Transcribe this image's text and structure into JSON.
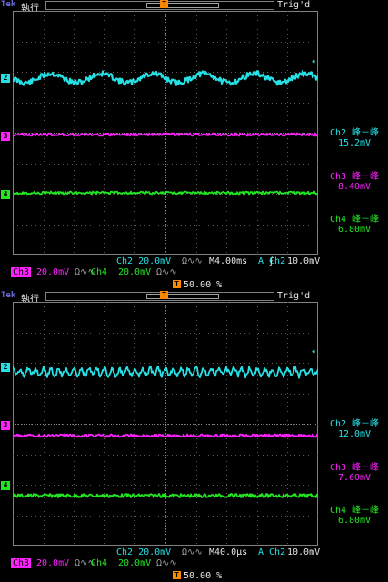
{
  "colors": {
    "ch2": "#27e0e6",
    "ch3": "#ff22ff",
    "ch4": "#22e622",
    "trigger": "#ff8a00",
    "grid": "#5a5a5a"
  },
  "screens": [
    {
      "brand": "Tek",
      "run_state": "執行",
      "trigger_status": "Trig'd",
      "trigger_position": "",
      "measurements": [
        {
          "label": "Ch2 峰－峰",
          "value": "15.2mV"
        },
        {
          "label": "Ch3 峰－峰",
          "value": "8.40mV"
        },
        {
          "label": "Ch4 峰－峰",
          "value": "6.80mV"
        }
      ],
      "footer": {
        "ch2_scale": "Ch2   20.0mV",
        "timebase": "M4.00ms",
        "trigger_src": "A  Ch2",
        "trigger_level": "10.0mV",
        "ch3_tag": "Ch3",
        "ch3_scale": "20.0mV",
        "ch4_tag": "Ch4",
        "ch4_scale": "20.0mV",
        "coupling_symbol": "Ω∿∿"
      },
      "trigger_marker": "T",
      "trigger_percent": "50.00 %",
      "channel_markers": [
        "2",
        "3",
        "4"
      ]
    },
    {
      "brand": "Tek",
      "run_state": "執行",
      "trigger_status": "Trig'd",
      "trigger_position": "50.00 %",
      "measurements": [
        {
          "label": "Ch2 峰－峰",
          "value": "12.0mV"
        },
        {
          "label": "Ch3 峰－峰",
          "value": "7.60mV"
        },
        {
          "label": "Ch4 峰－峰",
          "value": "6.80mV"
        }
      ],
      "footer": {
        "ch2_scale": "Ch2   20.0mV",
        "timebase": "M40.0µs",
        "trigger_src": "A  Ch2",
        "trigger_level": "10.0mV",
        "ch3_tag": "Ch3",
        "ch3_scale": "20.0mV",
        "ch4_tag": "Ch4",
        "ch4_scale": "20.0mV",
        "coupling_symbol": "Ω∿∿"
      },
      "trigger_marker": "T",
      "trigger_percent": "50.00 %",
      "channel_markers": [
        "2",
        "3",
        "4"
      ]
    }
  ]
}
